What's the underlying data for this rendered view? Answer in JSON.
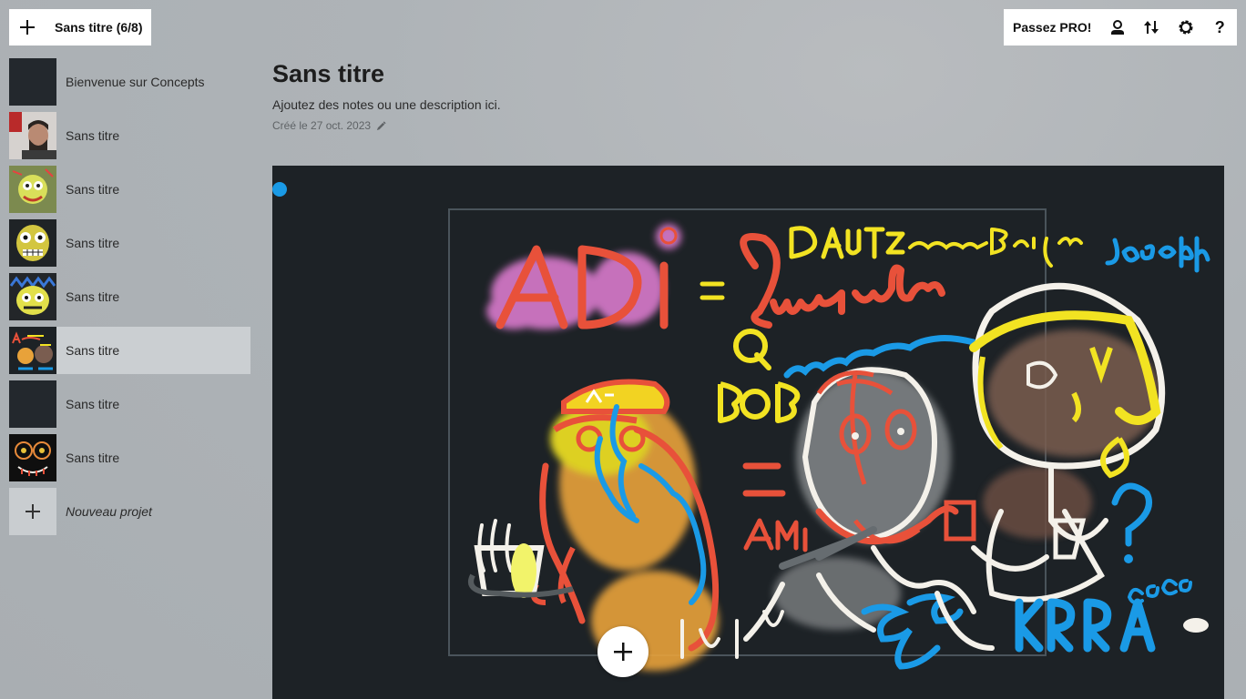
{
  "topbar": {
    "project_title": "Sans titre (6/8)",
    "pro_label": "Passez PRO!",
    "help_glyph": "?"
  },
  "sidebar": {
    "items": [
      {
        "label": "Bienvenue sur Concepts",
        "thumb": "dark"
      },
      {
        "label": "Sans titre",
        "thumb": "photo"
      },
      {
        "label": "Sans titre",
        "thumb": "green-art"
      },
      {
        "label": "Sans titre",
        "thumb": "yellow-face"
      },
      {
        "label": "Sans titre",
        "thumb": "yellow-blue"
      },
      {
        "label": "Sans titre",
        "thumb": "current",
        "active": true
      },
      {
        "label": "Sans titre",
        "thumb": "dark"
      },
      {
        "label": "Sans titre",
        "thumb": "orange-face"
      }
    ],
    "new_project_label": "Nouveau projet"
  },
  "main": {
    "title": "Sans titre",
    "description": "Ajoutez des notes ou une description ici.",
    "created": "Créé le 27 oct. 2023"
  },
  "drawing": {
    "texts": [
      "ADi",
      "=",
      "Quentin",
      "DAUTzami",
      "Beijar",
      "Joseph",
      "Q",
      "BOB",
      "=",
      "AMi",
      "KRRA",
      "coco",
      "?"
    ]
  },
  "colors": {
    "accent_active": "#cbcfd2",
    "canvas_bg": "#1d2226",
    "red": "#e8513a",
    "yellow": "#f2e322",
    "blue": "#1a9ae6",
    "pink": "#e47fd6",
    "white": "#f4f1ea"
  },
  "icons": [
    "plus-icon",
    "user-icon",
    "sort-icon",
    "gear-icon",
    "help-icon",
    "pencil-icon"
  ]
}
